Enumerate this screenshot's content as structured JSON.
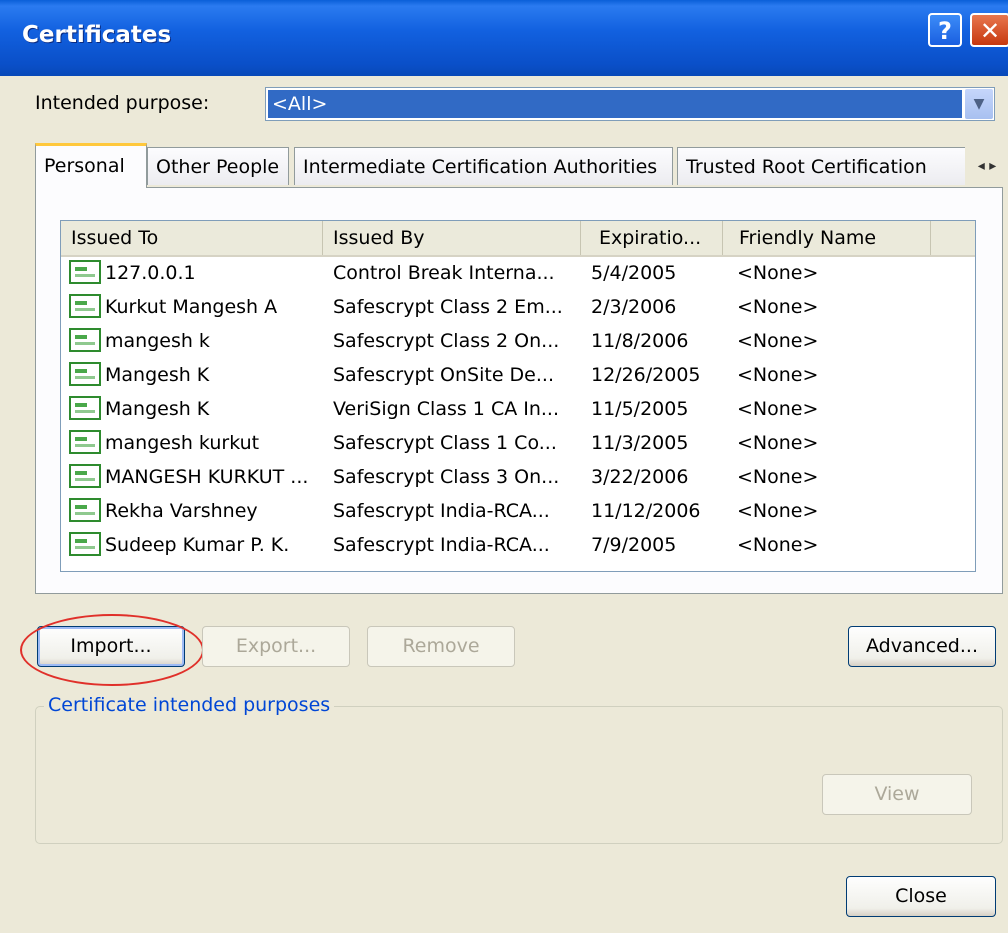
{
  "window": {
    "title": "Certificates",
    "help_glyph": "?",
    "close_glyph": "✕"
  },
  "purpose": {
    "label": "Intended purpose:",
    "value": "<All>"
  },
  "tabs": [
    {
      "label": "Personal",
      "active": true
    },
    {
      "label": "Other People",
      "active": false
    },
    {
      "label": "Intermediate Certification Authorities",
      "active": false
    },
    {
      "label": "Trusted Root Certification",
      "active": false
    }
  ],
  "tab_scroll": {
    "left": "◂",
    "right": "▸"
  },
  "table": {
    "columns": [
      "Issued To",
      "Issued By",
      "Expiratio...",
      "Friendly Name"
    ],
    "rows": [
      {
        "issued_to": "127.0.0.1",
        "issued_by": "Control Break Interna...",
        "expiration": "5/4/2005",
        "friendly": "<None>"
      },
      {
        "issued_to": "Kurkut Mangesh A",
        "issued_by": "Safescrypt Class 2 Em...",
        "expiration": "2/3/2006",
        "friendly": "<None>"
      },
      {
        "issued_to": "mangesh k",
        "issued_by": "Safescrypt Class 2 On...",
        "expiration": "11/8/2006",
        "friendly": "<None>"
      },
      {
        "issued_to": "Mangesh K",
        "issued_by": "Safescrypt OnSite De...",
        "expiration": "12/26/2005",
        "friendly": "<None>"
      },
      {
        "issued_to": "Mangesh K",
        "issued_by": "VeriSign Class 1 CA In...",
        "expiration": "11/5/2005",
        "friendly": "<None>"
      },
      {
        "issued_to": "mangesh kurkut",
        "issued_by": "Safescrypt Class 1 Co...",
        "expiration": "11/3/2005",
        "friendly": "<None>"
      },
      {
        "issued_to": "MANGESH KURKUT ...",
        "issued_by": "Safescrypt Class 3 On...",
        "expiration": "3/22/2006",
        "friendly": "<None>"
      },
      {
        "issued_to": "Rekha Varshney",
        "issued_by": "Safescrypt India-RCA...",
        "expiration": "11/12/2006",
        "friendly": "<None>"
      },
      {
        "issued_to": "Sudeep Kumar P. K.",
        "issued_by": "Safescrypt India-RCA...",
        "expiration": "7/9/2005",
        "friendly": "<None>"
      }
    ]
  },
  "buttons": {
    "import": "Import...",
    "export": "Export...",
    "remove": "Remove",
    "advanced": "Advanced...",
    "view": "View",
    "close": "Close"
  },
  "purposes_group": {
    "title": "Certificate intended purposes"
  }
}
